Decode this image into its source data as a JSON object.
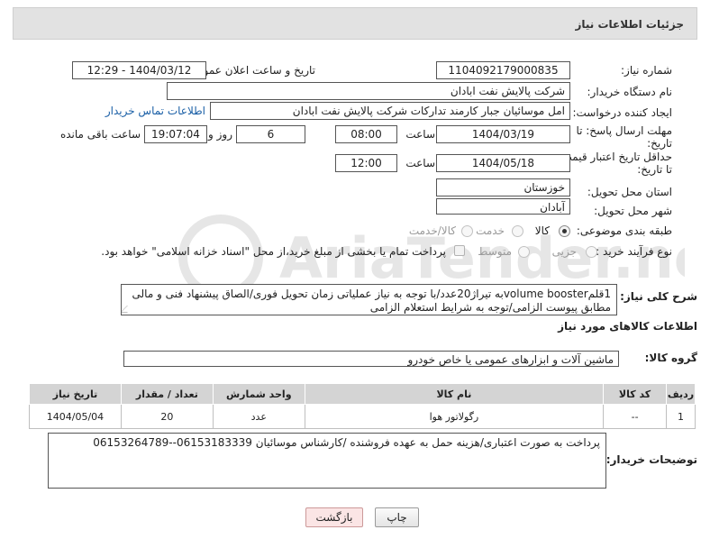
{
  "header": {
    "title": "جزئیات اطلاعات نیاز"
  },
  "fields": {
    "need_number_label": "شماره نیاز:",
    "need_number": "1104092179000835",
    "announce_label": "تاریخ و ساعت اعلان عمومی:",
    "announce_value": "1404/03/12 - 12:29",
    "buyer_org_label": "نام دستگاه خریدار:",
    "buyer_org": "شرکت پالایش نفت ابادان",
    "creator_label": "ایجاد کننده درخواست:",
    "creator": "امل موسائیان جبار کارمند تدارکات شرکت پالایش نفت ابادان",
    "buyer_contact_link": "اطلاعات تماس خریدار",
    "deadline_label_1": "مهلت ارسال پاسخ: تا",
    "deadline_label_2": "تاریخ:",
    "deadline_date": "1404/03/19",
    "time_label": "ساعت",
    "deadline_time": "08:00",
    "days_value": "6",
    "days_label": "روز و",
    "remaining_time": "19:07:04",
    "remaining_label": "ساعت باقی مانده",
    "price_valid_label_1": "حداقل تاریخ اعتبار قیمت:",
    "price_valid_label_2": "تا تاریخ:",
    "price_valid_date": "1404/05/18",
    "price_valid_time": "12:00",
    "province_label": "استان محل تحویل:",
    "province": "خوزستان",
    "city_label": "شهر محل تحویل:",
    "city": "آبادان",
    "category_label": "طبقه بندی موضوعی:",
    "category_options": [
      "کالا",
      "خدمت",
      "کالا/خدمت"
    ],
    "process_label": "نوع فرآیند خرید :",
    "process_options": [
      "جزیی",
      "متوسط"
    ],
    "payment_note": "پرداخت تمام یا بخشی از مبلغ خرید،از محل \"اسناد خزانه اسلامی\" خواهد بود.",
    "description_label": "شرح کلی نیاز:",
    "description": "1قلمvolume boosterبه تیراژ20عدد/با توجه به نیاز عملیاتی زمان تحویل فوری/الصاق پیشنهاد فنی و مالی مطابق پیوست الزامی/توجه به شرایط استعلام الزامی",
    "goods_info_title": "اطلاعات کالاهای مورد نیاز",
    "goods_group_label": "گروه کالا:",
    "goods_group": "ماشین آلات و ابزارهای عمومی یا خاص خودرو",
    "buyer_notes_label": "توضیحات خریدار:",
    "buyer_notes": "پرداخت به صورت اعتباری/هزینه حمل به عهده فروشنده /کارشناس موسائیان 06153183339--06153264789"
  },
  "table": {
    "headers": [
      "ردیف",
      "کد کالا",
      "نام کالا",
      "واحد شمارش",
      "تعداد / مقدار",
      "تاریخ نیاز"
    ],
    "rows": [
      [
        "1",
        "--",
        "رگولاتور هوا",
        "عدد",
        "20",
        "1404/05/04"
      ]
    ]
  },
  "buttons": {
    "print": "چاپ",
    "back": "بازگشت"
  },
  "watermark": "AriaTender.neT",
  "colors": {
    "header_bg": "#e2e2e2",
    "table_header_bg": "#d4d4d4",
    "link": "#1a5fa6",
    "back_button_bg": "#fbe5e5"
  }
}
